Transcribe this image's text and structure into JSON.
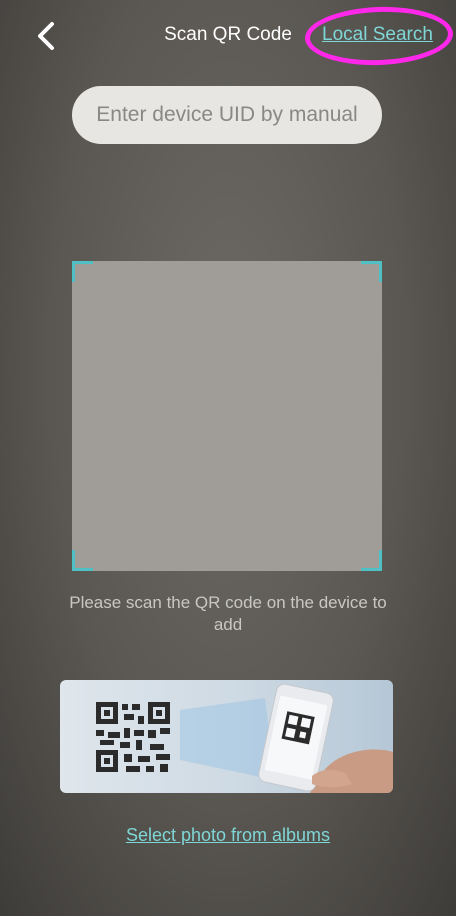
{
  "header": {
    "title": "Scan QR Code",
    "local_search_label": "Local Search",
    "back_icon": "chevron-left-icon"
  },
  "uid_input": {
    "placeholder": "Enter device UID by manual",
    "value": ""
  },
  "scanner": {
    "corner_color": "#4fc1c5",
    "instruction": "Please scan the QR code on the device to add"
  },
  "illustration": {
    "icons": [
      "qr-code-icon",
      "phone-scanning-icon"
    ]
  },
  "albums_link_label": "Select photo from albums",
  "colors": {
    "accent": "#7fd6d6",
    "highlight": "#ff27ea"
  }
}
